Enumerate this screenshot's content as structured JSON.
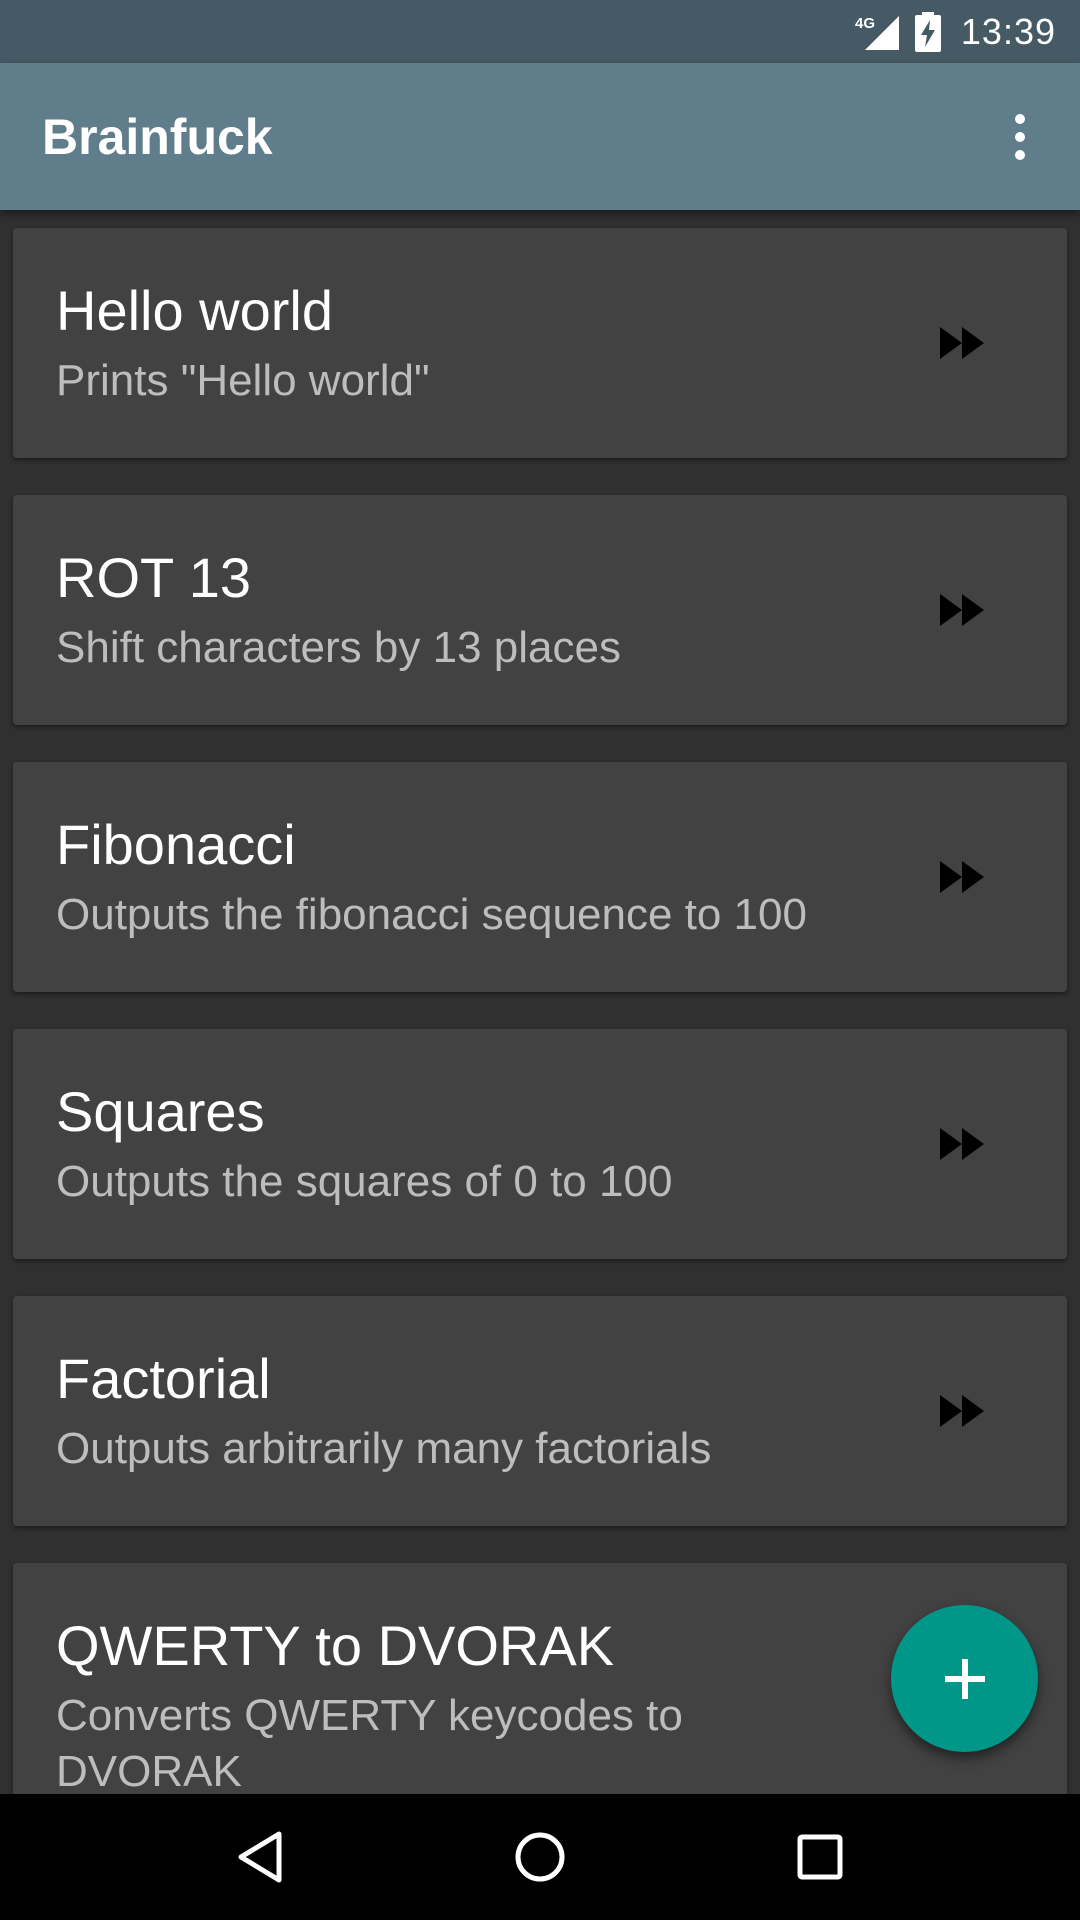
{
  "status_bar": {
    "network": "4G",
    "time": "13:39"
  },
  "app_bar": {
    "title": "Brainfuck",
    "overflow_icon": "more-vert-icon"
  },
  "programs": [
    {
      "title": "Hello world",
      "description": "Prints \"Hello world\"",
      "action_icon": "fast-forward-icon"
    },
    {
      "title": "ROT 13",
      "description": "Shift characters by 13 places",
      "action_icon": "fast-forward-icon"
    },
    {
      "title": "Fibonacci",
      "description": "Outputs the fibonacci sequence to 100",
      "action_icon": "fast-forward-icon"
    },
    {
      "title": "Squares",
      "description": "Outputs the squares of 0 to 100",
      "action_icon": "fast-forward-icon"
    },
    {
      "title": "Factorial",
      "description": "Outputs arbitrarily many factorials",
      "action_icon": "fast-forward-icon"
    },
    {
      "title": "QWERTY to DVORAK",
      "description": "Converts QWERTY keycodes to DVORAK",
      "action_icon": "fast-forward-icon"
    }
  ],
  "fab": {
    "icon": "add-icon"
  },
  "nav_bar": {
    "buttons": [
      "back-icon",
      "home-icon",
      "recents-icon"
    ]
  },
  "colors": {
    "status_bar": "#455a64",
    "app_bar": "#607d8b",
    "background": "#303030",
    "card": "#424242",
    "fab": "#009688"
  }
}
